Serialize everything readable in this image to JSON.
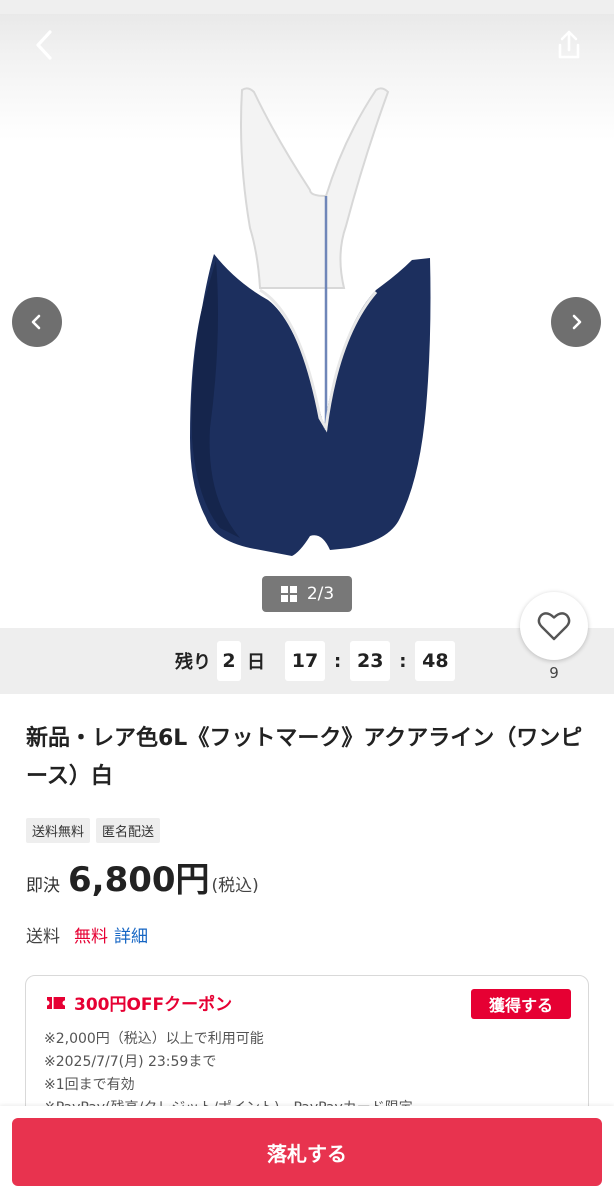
{
  "gallery": {
    "counter": "2/3",
    "icons": {
      "back": "chevron-left-icon",
      "share": "share-icon",
      "prev": "chevron-left-icon",
      "next": "chevron-right-icon",
      "grid": "grid-icon"
    }
  },
  "countdown": {
    "prefix": "残り",
    "days": "2",
    "days_unit": "日",
    "hours": "17",
    "minutes": "23",
    "seconds": "48",
    "separator": ":"
  },
  "favorite": {
    "count": "9",
    "icon": "heart-icon"
  },
  "item": {
    "title": "新品・レア色6L《フットマーク》アクアライン（ワンピース）白",
    "tags": [
      "送料無料",
      "匿名配送"
    ],
    "price_label": "即決",
    "price": "6,800円",
    "price_tax": "(税込)"
  },
  "shipping": {
    "label": "送料",
    "value": "無料",
    "detail_link": "詳細"
  },
  "coupon": {
    "title": "300円OFFクーポン",
    "get_button": "獲得する",
    "notes": [
      "※2,000円（税込）以上で利用可能",
      "※2025/7/7(月) 23:59まで",
      "※1回まで有効",
      "※PayPay(残高/クレジット/ポイント)、PayPayカード限定"
    ]
  },
  "colors": {
    "accent": "#e60033",
    "bid_button": "#e8334f",
    "link": "#1666c4",
    "swimsuit": "#1c2f5e"
  },
  "bottom": {
    "bid_button": "落札する"
  }
}
